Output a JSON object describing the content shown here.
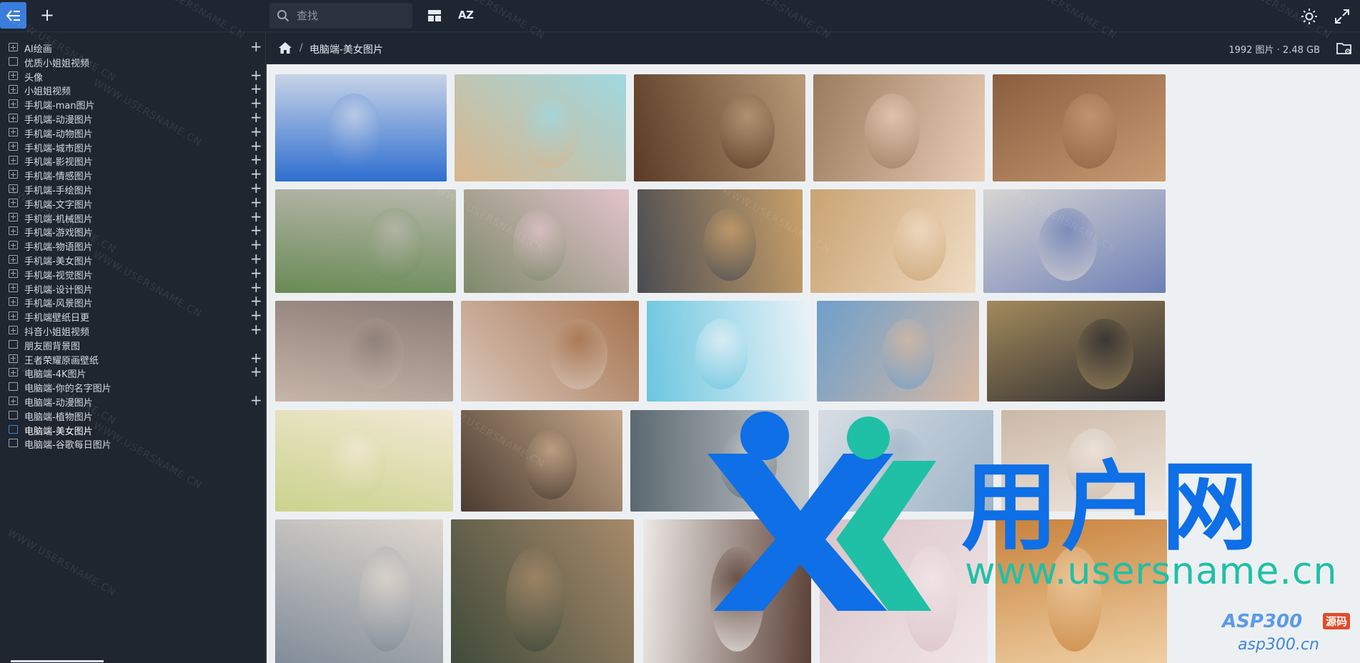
{
  "toolbar": {
    "back_icon": "back-arrow-icon",
    "add_icon": "plus-icon",
    "search_placeholder": "查找",
    "layout_icon": "grid-layout-icon",
    "sort_label": "AZ",
    "theme_icon": "sun-icon",
    "fullscreen_icon": "expand-icon"
  },
  "sidebar": {
    "items": [
      {
        "label": "AI绘画",
        "expandable": true,
        "addable": true
      },
      {
        "label": "优质小姐姐视频",
        "expandable": false,
        "addable": false
      },
      {
        "label": "头像",
        "expandable": true,
        "addable": true
      },
      {
        "label": "小姐姐视频",
        "expandable": true,
        "addable": true
      },
      {
        "label": "手机端-man图片",
        "expandable": true,
        "addable": true
      },
      {
        "label": "手机端-动漫图片",
        "expandable": true,
        "addable": true
      },
      {
        "label": "手机端-动物图片",
        "expandable": true,
        "addable": true
      },
      {
        "label": "手机端-城市图片",
        "expandable": true,
        "addable": true
      },
      {
        "label": "手机端-影视图片",
        "expandable": true,
        "addable": true
      },
      {
        "label": "手机端-情感图片",
        "expandable": true,
        "addable": true
      },
      {
        "label": "手机端-手绘图片",
        "expandable": true,
        "addable": true
      },
      {
        "label": "手机端-文字图片",
        "expandable": true,
        "addable": true
      },
      {
        "label": "手机端-机械图片",
        "expandable": true,
        "addable": true
      },
      {
        "label": "手机端-游戏图片",
        "expandable": true,
        "addable": true
      },
      {
        "label": "手机端-物语图片",
        "expandable": true,
        "addable": true
      },
      {
        "label": "手机端-美女图片",
        "expandable": true,
        "addable": true
      },
      {
        "label": "手机端-视觉图片",
        "expandable": true,
        "addable": true
      },
      {
        "label": "手机端-设计图片",
        "expandable": true,
        "addable": true
      },
      {
        "label": "手机端-风景图片",
        "expandable": true,
        "addable": true
      },
      {
        "label": "手机端壁纸日更",
        "expandable": true,
        "addable": true
      },
      {
        "label": "抖音小姐姐视频",
        "expandable": true,
        "addable": true
      },
      {
        "label": "朋友圈背景图",
        "expandable": false,
        "addable": false
      },
      {
        "label": "王者荣耀原画壁纸",
        "expandable": true,
        "addable": true
      },
      {
        "label": "电脑端-4K图片",
        "expandable": true,
        "addable": true
      },
      {
        "label": "电脑端-你的名字图片",
        "expandable": false,
        "addable": false
      },
      {
        "label": "电脑端-动漫图片",
        "expandable": true,
        "addable": true
      },
      {
        "label": "电脑端-植物图片",
        "expandable": false,
        "addable": false
      },
      {
        "label": "电脑端-美女图片",
        "expandable": false,
        "addable": false,
        "active": true
      },
      {
        "label": "电脑端-谷歌每日图片",
        "expandable": false,
        "addable": false
      }
    ]
  },
  "breadcrumb": {
    "home_icon": "home-icon",
    "separator": "/",
    "current": "电脑端-美女图片",
    "stats": "1992 图片 · 2.48 GB",
    "folder_menu_icon": "folder-settings-icon"
  },
  "gallery": {
    "photos": [
      {
        "name": "photo-1",
        "c1": "#2f6fd0",
        "c2": "#c7d3e6"
      },
      {
        "name": "photo-2",
        "c1": "#d9b58c",
        "c2": "#9fd8e0"
      },
      {
        "name": "photo-3",
        "c1": "#5a3a24",
        "c2": "#b89a78"
      },
      {
        "name": "photo-4",
        "c1": "#9c7b5e",
        "c2": "#e8cdb6"
      },
      {
        "name": "photo-5",
        "c1": "#8a5d3e",
        "c2": "#c99b74"
      },
      {
        "name": "photo-6",
        "c1": "#6a8a55",
        "c2": "#b8b8ad"
      },
      {
        "name": "photo-7",
        "c1": "#7d8a6a",
        "c2": "#e2c3cb"
      },
      {
        "name": "photo-8",
        "c1": "#4a4c52",
        "c2": "#c9a06a"
      },
      {
        "name": "photo-9",
        "c1": "#c9a372",
        "c2": "#f0dcc4"
      },
      {
        "name": "photo-10",
        "c1": "#d8d5d2",
        "c2": "#6d7fb6"
      },
      {
        "name": "photo-11",
        "c1": "#c6b5a8",
        "c2": "#8a7b75"
      },
      {
        "name": "photo-12",
        "c1": "#d9c7bb",
        "c2": "#a5734e"
      },
      {
        "name": "photo-13",
        "c1": "#6cc6e0",
        "c2": "#e8f2f7"
      },
      {
        "name": "photo-14",
        "c1": "#6e9fcb",
        "c2": "#d8b8a2"
      },
      {
        "name": "photo-15",
        "c1": "#a38a5c",
        "c2": "#2c2b2e"
      },
      {
        "name": "photo-16",
        "c1": "#c9d38c",
        "c2": "#f3e8d5"
      },
      {
        "name": "photo-17",
        "c1": "#4b3b31",
        "c2": "#c7a98a"
      },
      {
        "name": "photo-18",
        "c1": "#5b6870",
        "c2": "#c4c9cc"
      },
      {
        "name": "photo-19",
        "c1": "#d7dde4",
        "c2": "#9eb4c7"
      },
      {
        "name": "photo-20",
        "c1": "#cbb8a6",
        "c2": "#efe7df"
      },
      {
        "name": "photo-21",
        "c1": "#7e8a97",
        "c2": "#e0d8cf"
      },
      {
        "name": "photo-22",
        "c1": "#3e4a3a",
        "c2": "#a78a6a"
      },
      {
        "name": "photo-23",
        "c1": "#ece9e6",
        "c2": "#5a3f35"
      },
      {
        "name": "photo-24",
        "c1": "#d9c3c8",
        "c2": "#f2e6e8"
      },
      {
        "name": "photo-25",
        "c1": "#c8823c",
        "c2": "#f0d2a8"
      }
    ]
  },
  "watermarks": {
    "site_text": "WWW.USERSNAME.CN",
    "brand_cn": "用户网",
    "brand_url": "www.usersname.cn",
    "asp_logo": "ASP300",
    "asp_badge": "源码",
    "asp_url": "asp300.cn"
  },
  "colors": {
    "accent": "#3a7ddc",
    "panel": "#1f2630",
    "gallery_bg": "#edf0f3",
    "brand_blue": "#0e6fe6",
    "brand_teal": "#1fc0a6"
  }
}
